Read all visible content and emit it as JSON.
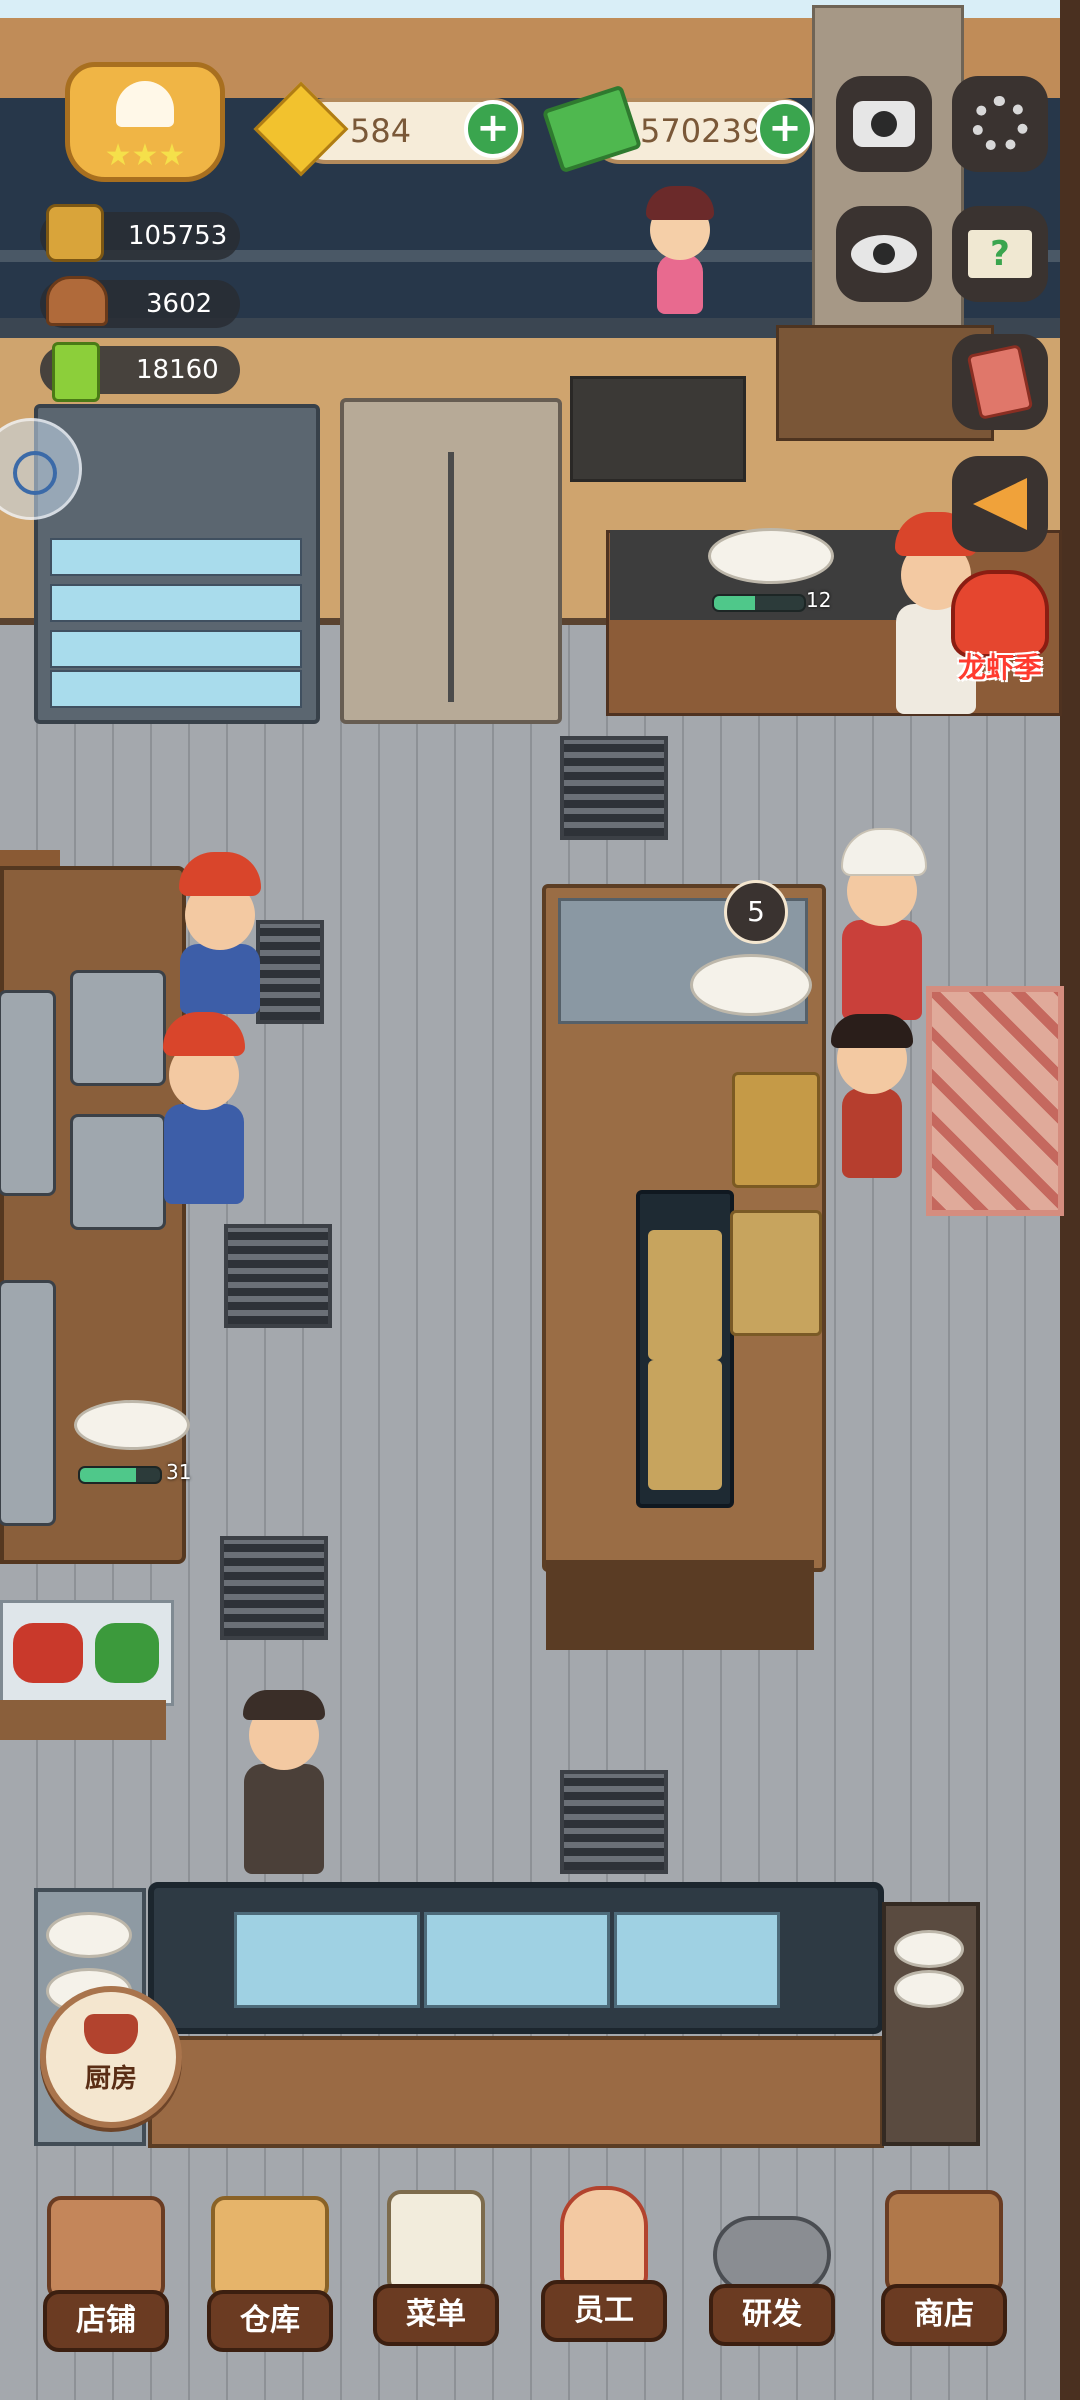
{
  "hud": {
    "gems": "584",
    "cash": "570239",
    "stat_gold": "105753",
    "stat_dishes": "3602",
    "stat_recipes": "18160"
  },
  "stations": {
    "stove_progress_count": "12",
    "stove_progress": 0.45,
    "prep_progress_count": "31",
    "prep_progress": 0.7,
    "island_timer": "5"
  },
  "event_badge": {
    "label": "龙虾季"
  },
  "kitchen_button": {
    "label": "厨房"
  },
  "nav": [
    {
      "label": "店铺",
      "icon": "shop-building-icon"
    },
    {
      "label": "仓库",
      "icon": "warehouse-boxes-icon"
    },
    {
      "label": "菜单",
      "icon": "menu-clipboard-icon"
    },
    {
      "label": "员工",
      "icon": "staff-chef-icon"
    },
    {
      "label": "研发",
      "icon": "research-wok-icon"
    },
    {
      "label": "商店",
      "icon": "store-stall-icon"
    }
  ],
  "colors": {
    "plus_button": "#3aa54e",
    "progress_fill": "#4fc88a",
    "nav_label_bg": "#6b3b22",
    "hud_pill_bg": "#f6ecd9"
  }
}
